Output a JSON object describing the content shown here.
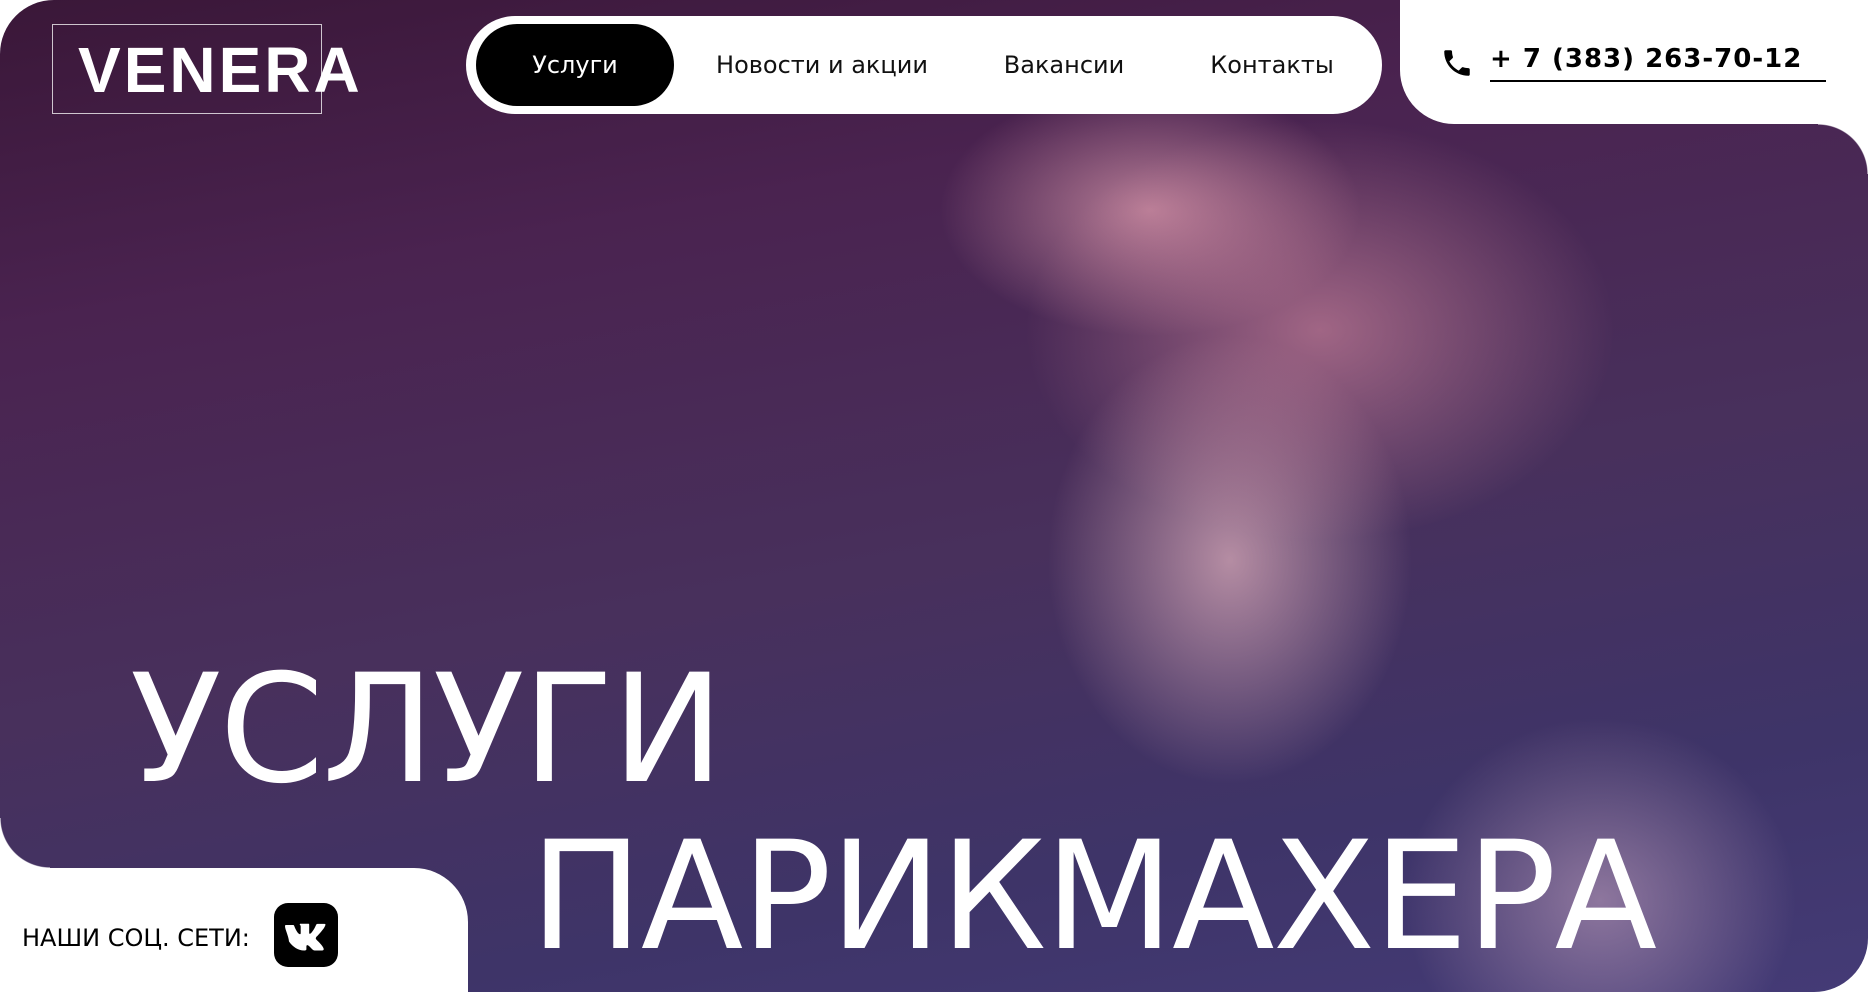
{
  "brand": {
    "logo_text": "VENERA"
  },
  "nav": {
    "items": [
      {
        "label": "Услуги",
        "active": true
      },
      {
        "label": "Новости и акции",
        "active": false
      },
      {
        "label": "Вакансии",
        "active": false
      },
      {
        "label": "Контакты",
        "active": false
      }
    ]
  },
  "contact": {
    "phone": "+ 7 (383) 263-70-12",
    "icon": "phone-icon"
  },
  "hero": {
    "line1": "УСЛУГИ",
    "line2": "ПАРИКМАХЕРА"
  },
  "social": {
    "label": "НАШИ СОЦ. СЕТИ:",
    "icon": "vk-icon"
  },
  "colors": {
    "nav_active": "#000000",
    "hero_bg": "#45295a",
    "text_light": "#ffffff"
  }
}
